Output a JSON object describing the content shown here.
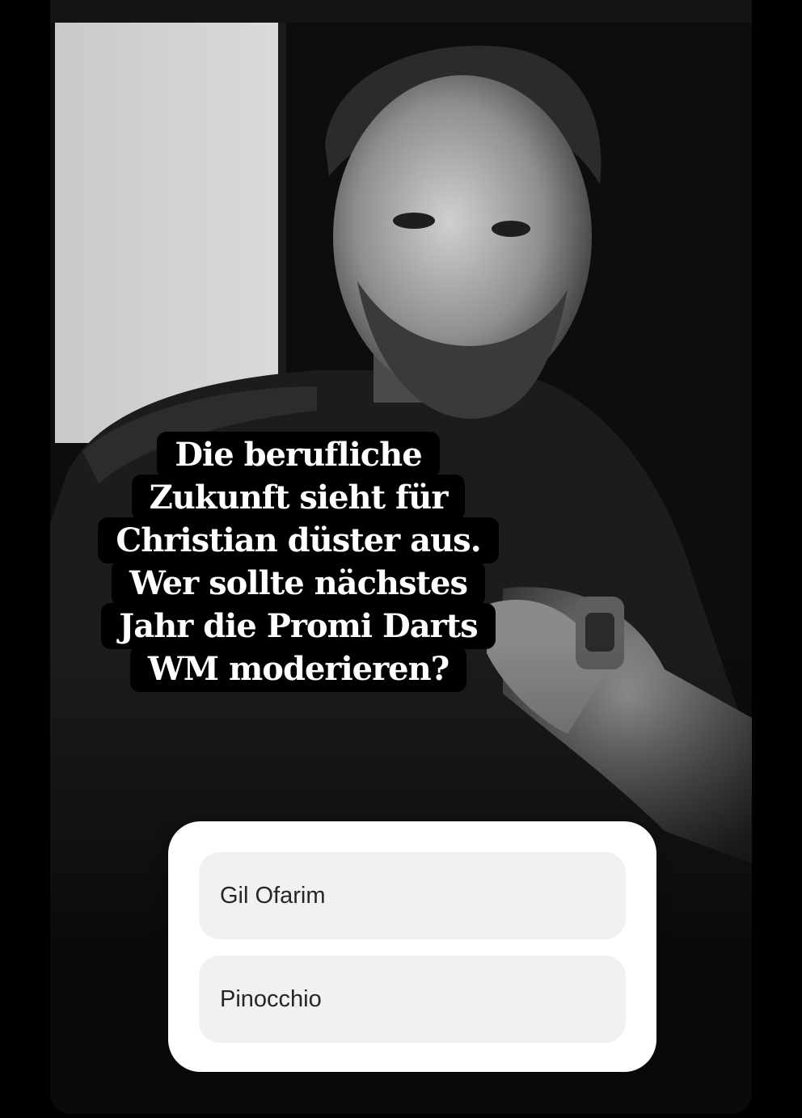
{
  "story": {
    "question_lines": [
      "Die berufliche",
      "Zukunft sieht für",
      "Christian düster aus.",
      "Wer sollte nächstes",
      "Jahr die Promi Darts",
      "WM moderieren?"
    ],
    "photo": {
      "icon": "portrait-photo"
    }
  },
  "poll": {
    "options": [
      {
        "label": "Gil Ofarim"
      },
      {
        "label": "Pinocchio"
      }
    ]
  },
  "colors": {
    "background": "#000000",
    "caption_background": "#000000",
    "caption_text": "#ffffff",
    "poll_card": "#ffffff",
    "poll_option": "#f1f1f4",
    "poll_text": "#262626"
  }
}
